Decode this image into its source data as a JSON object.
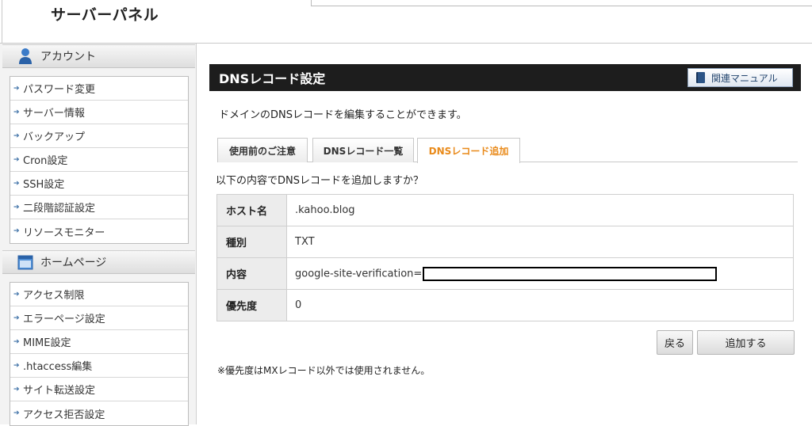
{
  "header": {
    "logo": "サーバーパネル"
  },
  "sidebar": {
    "sections": [
      {
        "title": "アカウント",
        "icon": "user-icon",
        "items": [
          "パスワード変更",
          "サーバー情報",
          "バックアップ",
          "Cron設定",
          "SSH設定",
          "二段階認証設定",
          "リソースモニター"
        ]
      },
      {
        "title": "ホームページ",
        "icon": "window-icon",
        "items": [
          "アクセス制限",
          "エラーページ設定",
          "MIME設定",
          ".htaccess編集",
          "サイト転送設定",
          "アクセス拒否設定"
        ]
      }
    ]
  },
  "main": {
    "title": "DNSレコード設定",
    "manual_label": "関連マニュアル",
    "description": "ドメインのDNSレコードを編集することができます。",
    "tabs": [
      {
        "label": "使用前のご注意",
        "active": false
      },
      {
        "label": "DNSレコード一覧",
        "active": false
      },
      {
        "label": "DNSレコード追加",
        "active": true
      }
    ],
    "confirm_text": "以下の内容でDNSレコードを追加しますか？",
    "record": [
      {
        "label": "ホスト名",
        "value": ".kahoo.blog"
      },
      {
        "label": "種別",
        "value": "TXT"
      },
      {
        "label": "内容",
        "value": "google-site-verification="
      },
      {
        "label": "優先度",
        "value": "0"
      }
    ],
    "back_label": "戻る",
    "add_label": "追加する",
    "note": "※優先度はMXレコード以外では使用されません。"
  },
  "colors": {
    "active_tab": "#e98a1a",
    "title_bar": "#1d1d1d",
    "arrow": "#3a6ea5"
  }
}
